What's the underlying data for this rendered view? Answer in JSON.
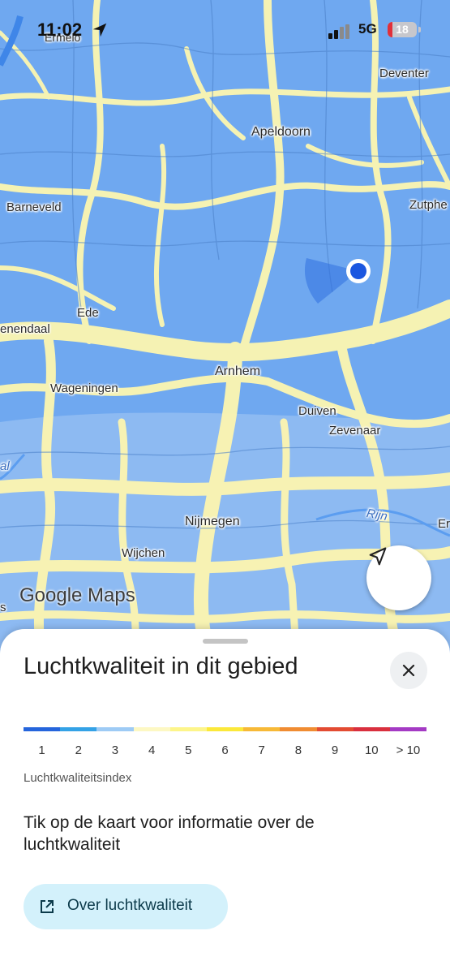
{
  "status_bar": {
    "time": "11:02",
    "network": "5G",
    "battery": "18",
    "battery_fraction": 0.18
  },
  "map": {
    "places": [
      {
        "name": "Ermelo",
        "size": "small"
      },
      {
        "name": "Deventer",
        "size": "small"
      },
      {
        "name": "Apeldoorn",
        "size": "big"
      },
      {
        "name": "Barneveld",
        "size": "small"
      },
      {
        "name": "Zutphe",
        "size": "small"
      },
      {
        "name": "Ede",
        "size": "small"
      },
      {
        "name": "enendaal",
        "size": "small"
      },
      {
        "name": "Arnhem",
        "size": "big"
      },
      {
        "name": "Wageningen",
        "size": "small"
      },
      {
        "name": "Duiven",
        "size": "small"
      },
      {
        "name": "Zevenaar",
        "size": "small"
      },
      {
        "name": "Rijn",
        "size": "small"
      },
      {
        "name": "Nijmegen",
        "size": "big"
      },
      {
        "name": "Wijchen",
        "size": "small"
      },
      {
        "name": "Er",
        "size": "small"
      },
      {
        "name": "s",
        "size": "small"
      },
      {
        "name": "al",
        "size": "small"
      }
    ],
    "logo": "Google Maps",
    "recenter_icon": "navigation-arrow-icon",
    "colors": {
      "clean_air": "#6fa8f0",
      "moderate": "#fdf6b0",
      "water": "#5b9df0",
      "location_dot": "#1a56e0"
    }
  },
  "sheet": {
    "title": "Luchtkwaliteit in dit gebied",
    "close_icon": "close-icon",
    "scale_colors": [
      "#2565dc",
      "#34a2e6",
      "#9ecbf5",
      "#fdf8c3",
      "#fdf58a",
      "#fbe83a",
      "#f7b937",
      "#f08c32",
      "#e34b32",
      "#d92f3e",
      "#a43ac4"
    ],
    "ticks": [
      "1",
      "2",
      "3",
      "4",
      "5",
      "6",
      "7",
      "8",
      "9",
      "10",
      "> 10"
    ],
    "index_label": "Luchtkwaliteitsindex",
    "info": "Tik op de kaart voor informatie over de luchtkwaliteit",
    "about_button": "Over luchtkwaliteit",
    "about_icon": "open-external-icon"
  }
}
